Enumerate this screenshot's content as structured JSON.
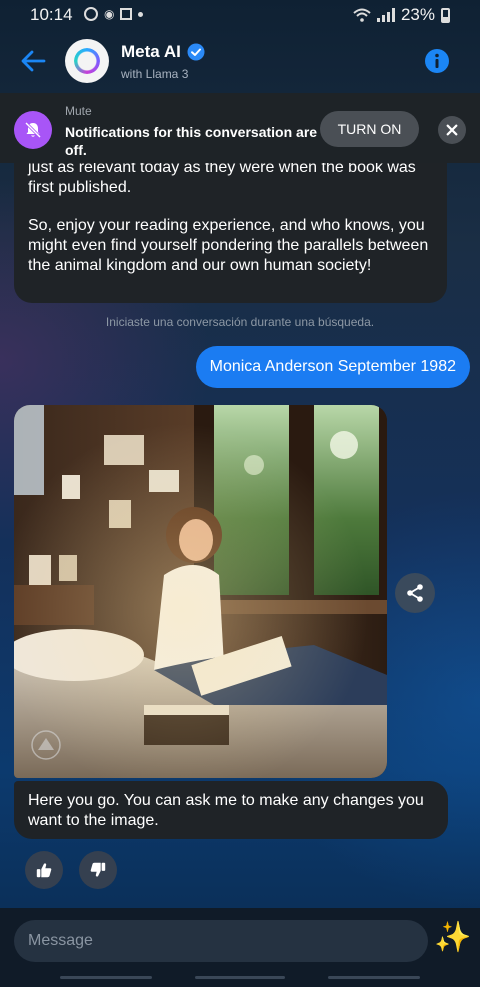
{
  "status_bar": {
    "time": "10:14",
    "battery_percent": "23%"
  },
  "header": {
    "title": "Meta AI",
    "subtitle": "with Llama 3"
  },
  "mute_banner": {
    "label": "Mute",
    "message": "Notifications for this conversation are off.",
    "turn_on_label": "TURN ON"
  },
  "messages": {
    "ai_cut_line": "just as relevant today as they were when the book was first published.",
    "ai_paragraph": "So, enjoy your reading experience, and who knows, you might even find yourself pondering the parallels between the animal kingdom and our own human society!",
    "system_note": "Iniciaste una conversación durante una búsqueda.",
    "user_message": "Monica Anderson September 1982",
    "ai_reply": "Here you go. You can ask me to make any changes you want to the image."
  },
  "composer": {
    "placeholder": "Message"
  },
  "colors": {
    "accent_blue": "#1b7cf2",
    "mute_purple": "#a855f7",
    "bubble_dark": "#1f2327"
  },
  "icons": [
    "back-arrow-icon",
    "verified-icon",
    "info-icon",
    "mute-bell-icon",
    "close-icon",
    "share-icon",
    "thumbs-up-icon",
    "thumbs-down-icon",
    "sparkle-icon"
  ]
}
